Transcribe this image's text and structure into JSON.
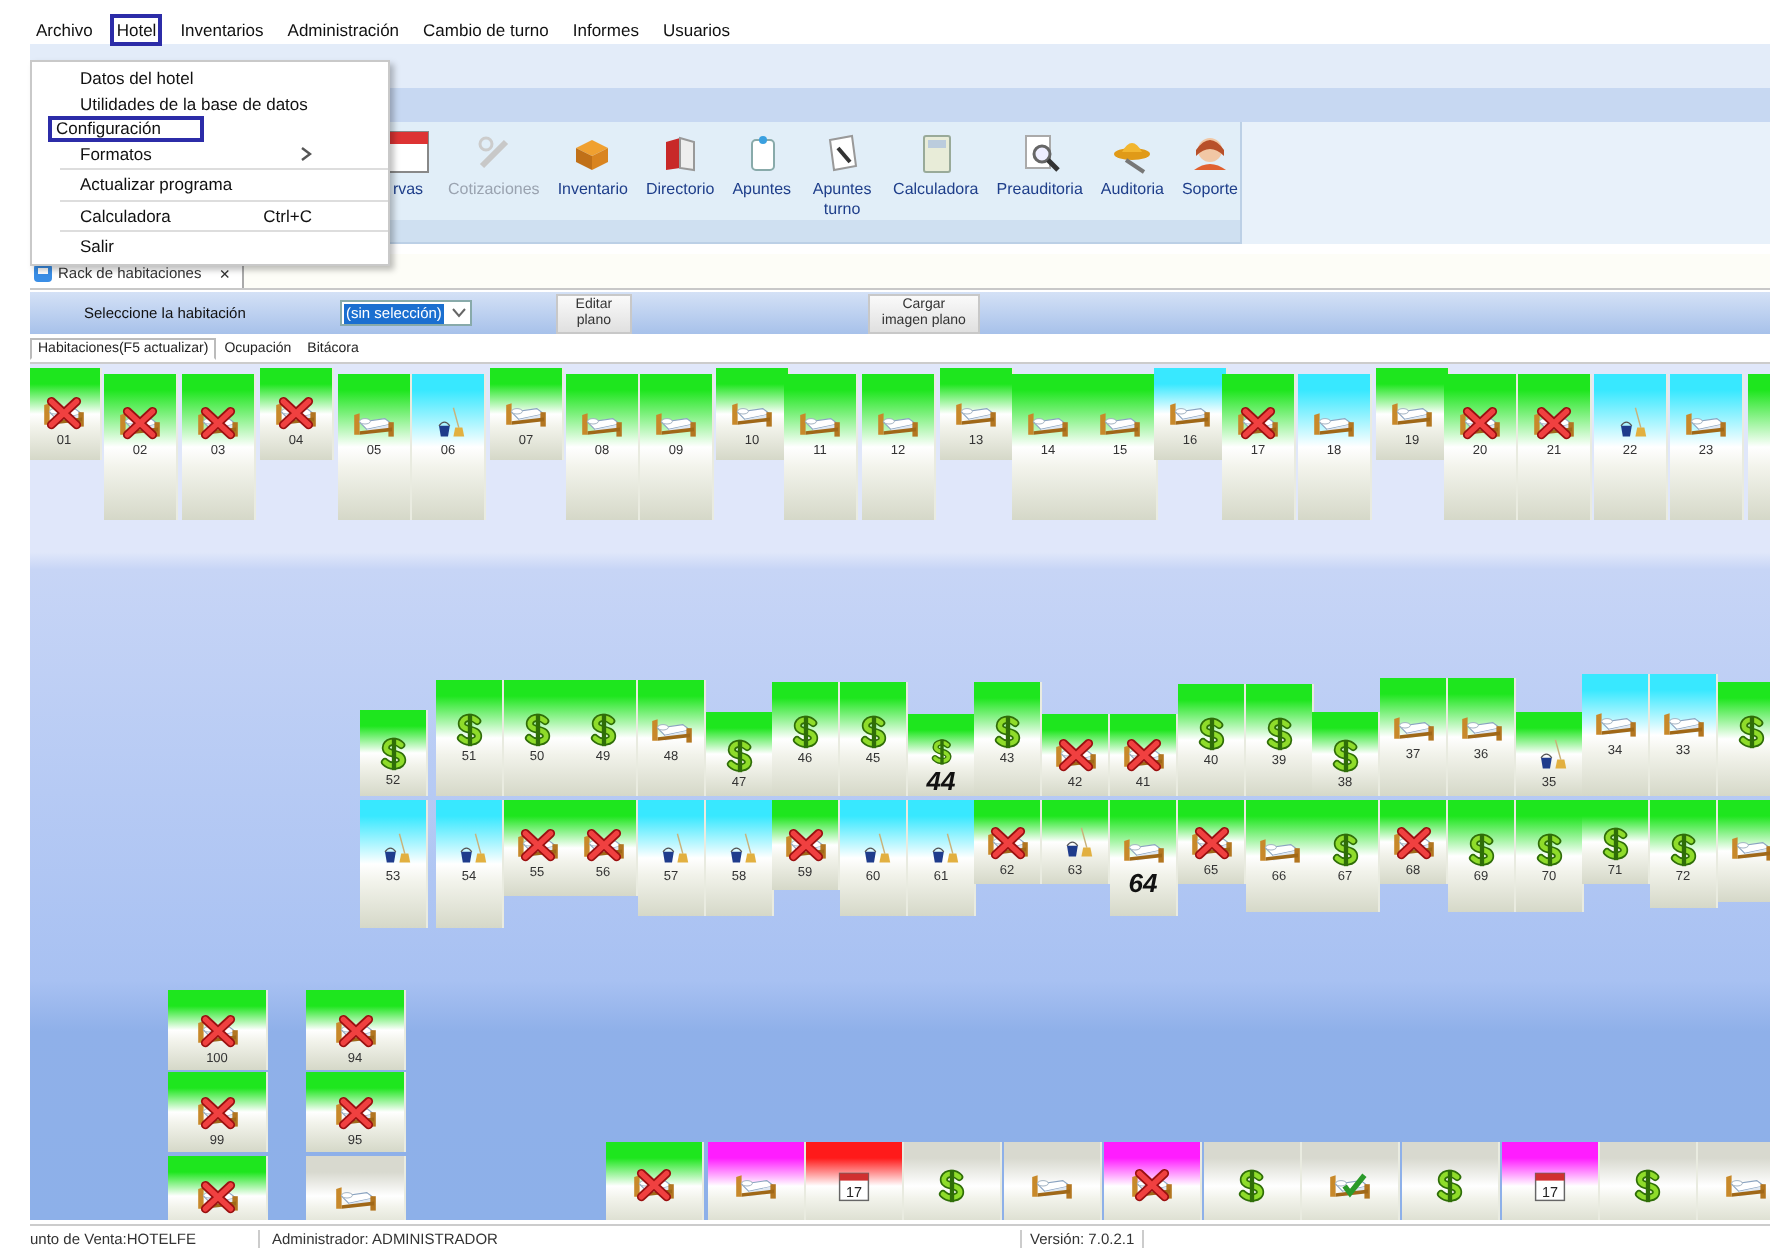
{
  "menu_bar": {
    "items": [
      {
        "label": "Archivo",
        "selected": false
      },
      {
        "label": "Hotel",
        "selected": true
      },
      {
        "label": "Inventarios",
        "selected": false
      },
      {
        "label": "Administración",
        "selected": false
      },
      {
        "label": "Cambio de turno",
        "selected": false
      },
      {
        "label": "Informes",
        "selected": false
      },
      {
        "label": "Usuarios",
        "selected": false
      }
    ]
  },
  "hotel_menu": {
    "items": [
      {
        "kind": "item",
        "label": "Datos del hotel",
        "selected": false,
        "submenu": false
      },
      {
        "kind": "item",
        "label": "Utilidades de la base de datos",
        "selected": false,
        "submenu": false
      },
      {
        "kind": "item",
        "label": "Configuración",
        "selected": true,
        "submenu": false
      },
      {
        "kind": "item",
        "label": "Formatos",
        "selected": false,
        "submenu": true
      },
      {
        "kind": "separator"
      },
      {
        "kind": "item",
        "label": "Actualizar programa",
        "selected": false,
        "submenu": false
      },
      {
        "kind": "separator"
      },
      {
        "kind": "item",
        "label": "Calculadora",
        "shortcut": "Ctrl+C",
        "selected": false,
        "submenu": false
      },
      {
        "kind": "separator"
      },
      {
        "kind": "item",
        "label": "Salir",
        "selected": false,
        "submenu": false
      }
    ]
  },
  "ribbon": {
    "buttons": [
      {
        "kind": "reservations",
        "label": "rvas",
        "disabled": false
      },
      {
        "kind": "quotes",
        "label": "Cotizaciones",
        "disabled": true
      },
      {
        "kind": "inventory",
        "label": "Inventario",
        "disabled": false
      },
      {
        "kind": "directory",
        "label": "Directorio",
        "disabled": false
      },
      {
        "kind": "notes",
        "label": "Apuntes",
        "disabled": false
      },
      {
        "kind": "shift_notes",
        "label": "Apuntes turno",
        "disabled": false
      },
      {
        "kind": "calculator",
        "label": "Calculadora",
        "disabled": false
      },
      {
        "kind": "preaudit",
        "label": "Preauditoria",
        "disabled": false
      },
      {
        "kind": "audit",
        "label": "Auditoria",
        "disabled": false
      },
      {
        "kind": "support",
        "label": "Soporte",
        "disabled": false
      }
    ]
  },
  "document_tab": {
    "label": "Rack de habitaciones",
    "close": "×"
  },
  "toolbar": {
    "room_label": "Seleccione la habitación",
    "room_select": {
      "value": "(sin selección)"
    },
    "buttons": [
      "Editar plano",
      "Cargar imagen plano"
    ]
  },
  "view_tabs": [
    {
      "label": "Habitaciones(F5 actualizar)",
      "selected": true
    },
    {
      "label": "Ocupación",
      "selected": false
    },
    {
      "label": "Bitácora",
      "selected": false
    }
  ],
  "rack": {
    "rooms": [
      {
        "number": "01",
        "kind": "occupied",
        "color": "#1ee61e",
        "selected": false
      },
      {
        "number": "02",
        "kind": "occupied",
        "color": "#1ee61e",
        "selected": false
      },
      {
        "number": "03",
        "kind": "occupied",
        "color": "#1ee61e",
        "selected": false
      },
      {
        "number": "04",
        "kind": "occupied",
        "color": "#1ee61e",
        "selected": false
      },
      {
        "number": "05",
        "kind": "vacant",
        "color": "#1ee61e",
        "selected": false
      },
      {
        "number": "06",
        "kind": "dirty",
        "color": "#38e8ff",
        "selected": false
      },
      {
        "number": "07",
        "kind": "vacant",
        "color": "#1ee61e",
        "selected": false
      },
      {
        "number": "08",
        "kind": "vacant",
        "color": "#1ee61e",
        "selected": false
      },
      {
        "number": "09",
        "kind": "vacant",
        "color": "#1ee61e",
        "selected": false
      },
      {
        "number": "10",
        "kind": "vacant",
        "color": "#1ee61e",
        "selected": false
      },
      {
        "number": "11",
        "kind": "vacant",
        "color": "#1ee61e",
        "selected": false
      },
      {
        "number": "12",
        "kind": "vacant",
        "color": "#1ee61e",
        "selected": false
      },
      {
        "number": "13",
        "kind": "vacant",
        "color": "#1ee61e",
        "selected": false
      },
      {
        "number": "14",
        "kind": "vacant",
        "color": "#1ee61e",
        "selected": false
      },
      {
        "number": "15",
        "kind": "vacant",
        "color": "#1ee61e",
        "selected": false
      },
      {
        "number": "16",
        "kind": "vacant",
        "color": "#38e8ff",
        "selected": false
      },
      {
        "number": "17",
        "kind": "occupied",
        "color": "#1ee61e",
        "selected": false
      },
      {
        "number": "18",
        "kind": "vacant",
        "color": "#38e8ff",
        "selected": false
      },
      {
        "number": "19",
        "kind": "vacant",
        "color": "#1ee61e",
        "selected": false
      },
      {
        "number": "20",
        "kind": "occupied",
        "color": "#1ee61e",
        "selected": false
      },
      {
        "number": "21",
        "kind": "occupied",
        "color": "#1ee61e",
        "selected": false
      },
      {
        "number": "22",
        "kind": "dirty",
        "color": "#38e8ff",
        "selected": false
      },
      {
        "number": "23",
        "kind": "vacant",
        "color": "#38e8ff",
        "selected": false
      },
      {
        "kind": "blank",
        "color": "#1ee61e"
      },
      {
        "number": "52",
        "kind": "paid",
        "color": "#1ee61e",
        "selected": false
      },
      {
        "number": "51",
        "kind": "paid",
        "color": "#1ee61e",
        "selected": false
      },
      {
        "number": "50",
        "kind": "paid",
        "color": "#1ee61e",
        "selected": false
      },
      {
        "number": "49",
        "kind": "paid",
        "color": "#1ee61e",
        "selected": false
      },
      {
        "number": "48",
        "kind": "vacant",
        "color": "#1ee61e",
        "selected": false
      },
      {
        "number": "47",
        "kind": "paid",
        "color": "#1ee61e",
        "selected": false
      },
      {
        "number": "46",
        "kind": "paid",
        "color": "#1ee61e",
        "selected": false
      },
      {
        "number": "45",
        "kind": "paid",
        "color": "#1ee61e",
        "selected": false
      },
      {
        "number": "44",
        "kind": "paid",
        "color": "#1ee61e",
        "selected": true
      },
      {
        "number": "43",
        "kind": "paid",
        "color": "#1ee61e",
        "selected": false
      },
      {
        "number": "42",
        "kind": "occupied",
        "color": "#1ee61e",
        "selected": false
      },
      {
        "number": "41",
        "kind": "occupied",
        "color": "#1ee61e",
        "selected": false
      },
      {
        "number": "40",
        "kind": "paid",
        "color": "#1ee61e",
        "selected": false
      },
      {
        "number": "39",
        "kind": "paid",
        "color": "#1ee61e",
        "selected": false
      },
      {
        "number": "38",
        "kind": "paid",
        "color": "#1ee61e",
        "selected": false
      },
      {
        "number": "37",
        "kind": "vacant",
        "color": "#1ee61e",
        "selected": false
      },
      {
        "number": "36",
        "kind": "vacant",
        "color": "#1ee61e",
        "selected": false
      },
      {
        "number": "35",
        "kind": "dirty",
        "color": "#1ee61e",
        "selected": false
      },
      {
        "number": "34",
        "kind": "vacant",
        "color": "#38e8ff",
        "selected": false
      },
      {
        "number": "33",
        "kind": "vacant",
        "color": "#38e8ff",
        "selected": false
      },
      {
        "kind": "paid",
        "color": "#1ee61e"
      },
      {
        "number": "53",
        "kind": "dirty",
        "color": "#38e8ff",
        "selected": false
      },
      {
        "number": "54",
        "kind": "dirty",
        "color": "#38e8ff",
        "selected": false
      },
      {
        "number": "55",
        "kind": "occupied",
        "color": "#1ee61e",
        "selected": false
      },
      {
        "number": "56",
        "kind": "occupied",
        "color": "#1ee61e",
        "selected": false
      },
      {
        "number": "57",
        "kind": "dirty",
        "color": "#38e8ff",
        "selected": false
      },
      {
        "number": "58",
        "kind": "dirty",
        "color": "#38e8ff",
        "selected": false
      },
      {
        "number": "59",
        "kind": "occupied",
        "color": "#1ee61e",
        "selected": false
      },
      {
        "number": "60",
        "kind": "dirty",
        "color": "#38e8ff",
        "selected": false
      },
      {
        "number": "61",
        "kind": "dirty",
        "color": "#38e8ff",
        "selected": false
      },
      {
        "number": "62",
        "kind": "occupied",
        "color": "#1ee61e",
        "selected": false
      },
      {
        "number": "63",
        "kind": "dirty",
        "color": "#1ee61e",
        "selected": false
      },
      {
        "number": "64",
        "kind": "vacant",
        "color": "#1ee61e",
        "selected": true
      },
      {
        "number": "65",
        "kind": "occupied",
        "color": "#1ee61e",
        "selected": false
      },
      {
        "number": "66",
        "kind": "vacant",
        "color": "#1ee61e",
        "selected": false
      },
      {
        "number": "67",
        "kind": "paid",
        "color": "#1ee61e",
        "selected": false
      },
      {
        "number": "68",
        "kind": "occupied",
        "color": "#1ee61e",
        "selected": false
      },
      {
        "number": "69",
        "kind": "paid",
        "color": "#1ee61e",
        "selected": false
      },
      {
        "number": "70",
        "kind": "paid",
        "color": "#1ee61e",
        "selected": false
      },
      {
        "number": "71",
        "kind": "paid",
        "color": "#1ee61e",
        "selected": false
      },
      {
        "number": "72",
        "kind": "paid",
        "color": "#1ee61e",
        "selected": false
      },
      {
        "kind": "vacant",
        "color": "#1ee61e"
      },
      {
        "number": "100",
        "kind": "occupied",
        "color": "#1ee61e",
        "selected": false
      },
      {
        "number": "94",
        "kind": "occupied",
        "color": "#1ee61e",
        "selected": false
      },
      {
        "number": "99",
        "kind": "occupied",
        "color": "#1ee61e",
        "selected": false
      },
      {
        "number": "95",
        "kind": "occupied",
        "color": "#1ee61e",
        "selected": false
      },
      {
        "kind": "occupied",
        "color": "#1ee61e"
      },
      {
        "kind": "vacant",
        "color": "#d8d9cf"
      },
      {
        "kind": "occupied",
        "color": "#1ee61e"
      },
      {
        "kind": "vacant",
        "color": "#ff1dff"
      },
      {
        "kind": "reserved",
        "calendar_day": "17",
        "color": "#ff1a1a"
      },
      {
        "kind": "paid",
        "color": "#d8d9cf"
      },
      {
        "kind": "vacant",
        "color": "#d8d9cf"
      },
      {
        "kind": "occupied",
        "color": "#ff1dff"
      },
      {
        "kind": "paid",
        "color": "#d8d9cf"
      },
      {
        "kind": "checked",
        "color": "#d8d9cf"
      },
      {
        "kind": "paid",
        "color": "#d8d9cf"
      },
      {
        "kind": "reserved",
        "calendar_day": "17",
        "color": "#ff1dff"
      },
      {
        "kind": "paid",
        "color": "#d8d9cf"
      },
      {
        "kind": "vacant",
        "color": "#d8d9cf"
      }
    ]
  },
  "status_bar": [
    "unto de Venta:HOTELFE",
    "Administrador: ADMINISTRADOR",
    "Versión: 7.0.2.1"
  ]
}
